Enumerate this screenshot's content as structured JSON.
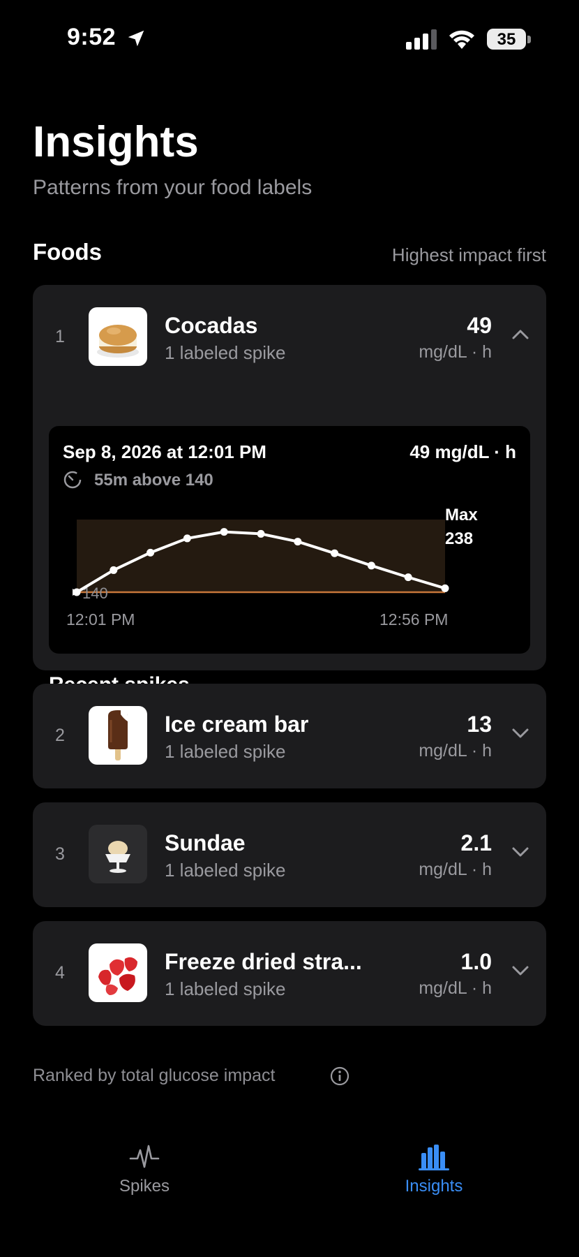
{
  "status_bar": {
    "time": "9:52",
    "battery": "35"
  },
  "header": {
    "title": "Insights",
    "subtitle": "Patterns from your food labels"
  },
  "foods_section": {
    "title": "Foods",
    "sort_label": "Highest impact first"
  },
  "foods": [
    {
      "rank": "1",
      "name": "Cocadas",
      "subtitle": "1 labeled spike",
      "value": "49",
      "unit": "mg/dL · h",
      "expanded": true,
      "thumb_icon": "cocada-icon"
    },
    {
      "rank": "2",
      "name": "Ice cream bar",
      "subtitle": "1 labeled spike",
      "value": "13",
      "unit": "mg/dL · h",
      "expanded": false,
      "thumb_icon": "ice-cream-bar-icon"
    },
    {
      "rank": "3",
      "name": "Sundae",
      "subtitle": "1 labeled spike",
      "value": "2.1",
      "unit": "mg/dL · h",
      "expanded": false,
      "thumb_icon": "sundae-icon"
    },
    {
      "rank": "4",
      "name": "Freeze dried stra...",
      "subtitle": "1 labeled spike",
      "value": "1.0",
      "unit": "mg/dL · h",
      "expanded": false,
      "thumb_icon": "strawberries-icon"
    }
  ],
  "recent_spikes": {
    "title": "Recent spikes",
    "date": "Sep 8, 2026 at 12:01 PM",
    "value": "49 mg/dL · h",
    "duration": "55m above 140",
    "max_label": "Max",
    "max_value": "238",
    "x_start": "12:01 PM",
    "x_end": "12:56 PM",
    "threshold_label": "140"
  },
  "chart_data": {
    "type": "line",
    "title": "",
    "xlabel": "",
    "ylabel": "",
    "x": [
      "12:01 PM",
      "12:06 PM",
      "12:12 PM",
      "12:17 PM",
      "12:23 PM",
      "12:28 PM",
      "12:34 PM",
      "12:39 PM",
      "12:45 PM",
      "12:50 PM",
      "12:56 PM"
    ],
    "x_tick_labels": [
      "12:01 PM",
      "12:56 PM"
    ],
    "values": [
      140,
      174,
      201,
      223,
      233,
      230,
      218,
      200,
      181,
      163,
      146
    ],
    "threshold": 140,
    "max": 238,
    "ylim": [
      140,
      252
    ],
    "grid": false,
    "colors": {
      "line": "#ffffff",
      "threshold": "#c8773a",
      "fill": "#241a10"
    }
  },
  "footnote": "Ranked by total glucose impact",
  "tabs": [
    {
      "label": "Spikes",
      "active": false,
      "icon": "pulse-icon"
    },
    {
      "label": "Insights",
      "active": true,
      "icon": "bar-chart-icon"
    }
  ],
  "colors": {
    "accent": "#3a8ef6",
    "card": "#1c1c1e",
    "secondary_text": "#9a9a9f"
  }
}
